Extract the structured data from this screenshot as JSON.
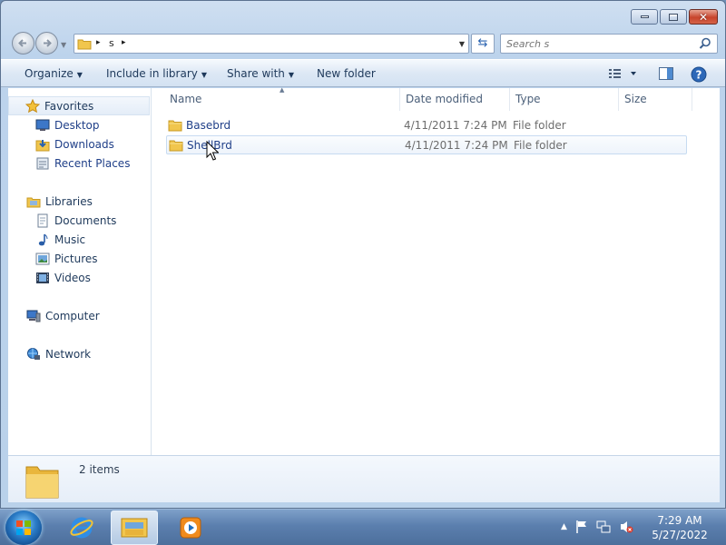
{
  "window": {
    "controls": {
      "minimize": "minimize-icon",
      "maximize": "maximize-icon",
      "close": "close-icon"
    }
  },
  "address": {
    "path_segments": [
      "s"
    ],
    "separator": "▸",
    "search_placeholder": "Search s"
  },
  "toolbar": {
    "organize": "Organize",
    "include_in_library": "Include in library",
    "share_with": "Share with",
    "new_folder": "New folder"
  },
  "navpane": {
    "favorites": {
      "label": "Favorites",
      "icon": "star-icon",
      "items": [
        {
          "label": "Desktop",
          "icon": "desktop-icon"
        },
        {
          "label": "Downloads",
          "icon": "downloads-icon"
        },
        {
          "label": "Recent Places",
          "icon": "recent-places-icon"
        }
      ]
    },
    "libraries": {
      "label": "Libraries",
      "icon": "libraries-icon",
      "items": [
        {
          "label": "Documents",
          "icon": "documents-icon"
        },
        {
          "label": "Music",
          "icon": "music-icon"
        },
        {
          "label": "Pictures",
          "icon": "pictures-icon"
        },
        {
          "label": "Videos",
          "icon": "videos-icon"
        }
      ]
    },
    "computer": {
      "label": "Computer",
      "icon": "computer-icon"
    },
    "network": {
      "label": "Network",
      "icon": "network-icon"
    }
  },
  "columns": {
    "name": "Name",
    "date_modified": "Date modified",
    "type": "Type",
    "size": "Size"
  },
  "files": [
    {
      "name": "Basebrd",
      "date_modified": "4/11/2011 7:24 PM",
      "type": "File folder",
      "size": ""
    },
    {
      "name": "ShellBrd",
      "date_modified": "4/11/2011 7:24 PM",
      "type": "File folder",
      "size": ""
    }
  ],
  "details": {
    "item_count": "2 items"
  },
  "taskbar": {
    "clock_time": "7:29 AM",
    "clock_date": "5/27/2022"
  },
  "colors": {
    "accent": "#2a63b0",
    "link": "#1f3f88",
    "folder": "#f1c64d"
  }
}
